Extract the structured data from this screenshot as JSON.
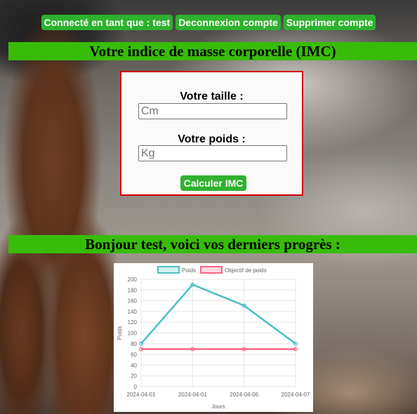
{
  "header": {
    "user_label": "Connecté en tant que : test",
    "logout_label": "Deconnexion compte",
    "delete_label": "Supprimer compte"
  },
  "imc": {
    "title": "Votre indice de masse corporelle (IMC)",
    "height_label": "Votre taille :",
    "height_placeholder": "Cm",
    "weight_label": "Votre poids :",
    "weight_placeholder": "Kg",
    "calc_label": "Calculer IMC"
  },
  "progress": {
    "title": "Bonjour test, voici vos derniers progrès :"
  },
  "colors": {
    "accent": "#2fb12f",
    "banner": "#37bd08",
    "form_border": "#d40000",
    "series_weight": "#4bc0c0",
    "series_goal": "#ff6384"
  },
  "chart_data": {
    "type": "line",
    "x": [
      "2024-04-01",
      "2024-04-01",
      "2024-04-06",
      "2024-04-07"
    ],
    "series": [
      {
        "name": "Poids",
        "values": [
          80,
          190,
          151,
          80
        ]
      },
      {
        "name": "Objectif de poids",
        "values": [
          70,
          70,
          70,
          70
        ]
      }
    ],
    "xlabel": "Jours",
    "ylabel": "Poids",
    "ylim": [
      0,
      200
    ],
    "yticks": [
      "0",
      "20",
      "40",
      "60",
      "80",
      "100",
      "120",
      "140",
      "160",
      "180",
      "200"
    ],
    "grid": true,
    "legend": "top"
  }
}
